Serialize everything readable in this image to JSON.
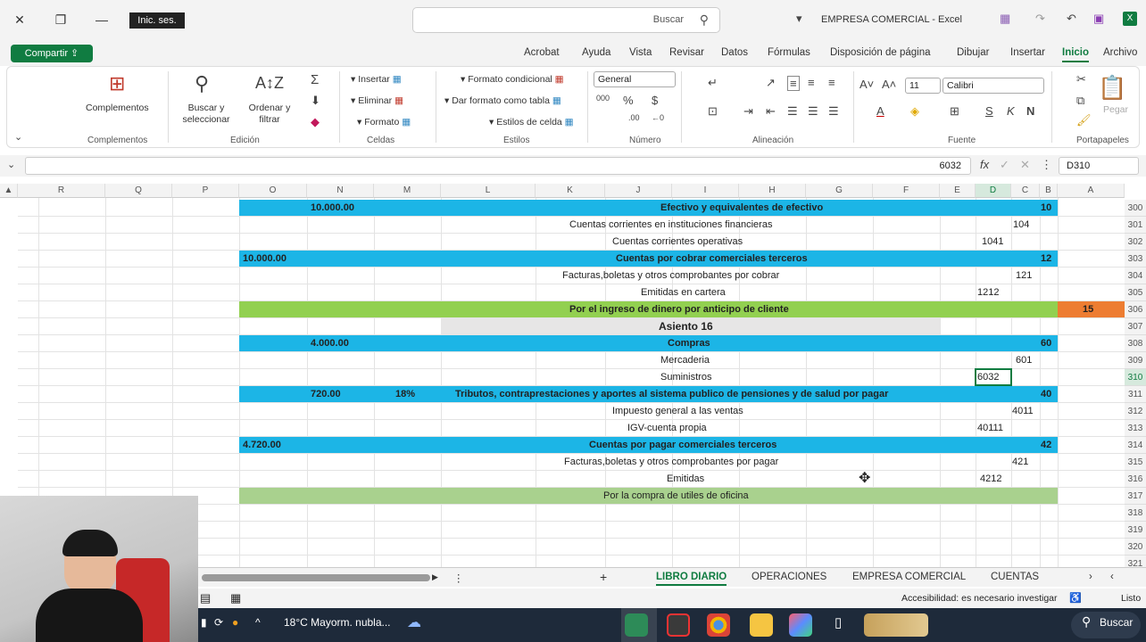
{
  "titlebar": {
    "signin": "Inic. ses.",
    "search_label": "Buscar",
    "title": "EMPRESA COMERCIAL  -  Excel"
  },
  "menu": {
    "tabs": [
      "Archivo",
      "Inicio",
      "Insertar",
      "Dibujar",
      "Disposición de página",
      "Fórmulas",
      "Datos",
      "Revisar",
      "Vista",
      "Ayuda",
      "Acrobat"
    ],
    "share": "Compartir"
  },
  "ribbon": {
    "groups": [
      "Portapapeles",
      "Fuente",
      "Alineación",
      "Número",
      "Estilos",
      "Celdas",
      "Edición",
      "Complementos"
    ],
    "paste": "Pegar",
    "font_name": "Calibri",
    "font_size": "11",
    "number_format": "General",
    "conditional": "Formato condicional",
    "as_table": "Dar formato como tabla",
    "cell_styles": "Estilos de celda",
    "insert": "Insertar",
    "delete": "Eliminar",
    "format": "Formato",
    "sort": "Ordenar y filtrar",
    "find": "Buscar y seleccionar",
    "addins": "Complementos"
  },
  "formula_bar": {
    "name_box": "D310",
    "formula": "6032"
  },
  "columns": [
    "A",
    "B",
    "C",
    "D",
    "E",
    "F",
    "G",
    "H",
    "I",
    "J",
    "K",
    "L",
    "M",
    "N",
    "O",
    "P",
    "Q",
    "R"
  ],
  "rows": [
    "300",
    "301",
    "302",
    "303",
    "304",
    "305",
    "306",
    "307",
    "308",
    "309",
    "310",
    "311",
    "312",
    "313",
    "314",
    "315",
    "316",
    "317",
    "318",
    "319",
    "320",
    "321"
  ],
  "cells": {
    "r300_code": "10",
    "r300_desc": "Efectivo y equivalentes de efectivo",
    "r300_debe": "10.000.00",
    "r301_code": "104",
    "r301_desc": "Cuentas corrientes en instituciones financieras",
    "r302_code": "1041",
    "r302_desc": "Cuentas corrientes operativas",
    "r303_code": "12",
    "r303_desc": "Cuentas por cobrar comerciales terceros",
    "r303_haber": "10.000.00",
    "r304_code": "121",
    "r304_desc": "Facturas,boletas y otros comprobantes por cobrar",
    "r305_code": "1212",
    "r305_desc": "Emitidas en cartera",
    "r306_num": "15",
    "r306_desc": "Por el ingreso de dinero por anticipo de cliente",
    "r307_desc": "Asiento 16",
    "r308_code": "60",
    "r308_desc": "Compras",
    "r308_debe": "4.000.00",
    "r309_code": "601",
    "r309_desc": "Mercaderia",
    "r310_code": "6032",
    "r310_desc": "Suministros",
    "r311_code": "40",
    "r311_desc": "Tributos, contraprestaciones y aportes al sistema publico de pensiones y de salud por pagar",
    "r311_pct": "18%",
    "r311_debe": "720.00",
    "r312_code": "4011",
    "r312_desc": "Impuesto general a las ventas",
    "r313_code": "40111",
    "r313_desc": "IGV-cuenta propia",
    "r314_code": "42",
    "r314_desc": "Cuentas por pagar comerciales terceros",
    "r314_haber": "4.720.00",
    "r315_code": "421",
    "r315_desc": "Facturas,boletas y otros comprobantes por pagar",
    "r316_code": "4212",
    "r316_desc": "Emitidas",
    "r317_desc": "Por la compra de utiles de oficina"
  },
  "sheets": [
    "CUENTAS",
    "EMPRESA COMERCIAL",
    "OPERACIONES",
    "LIBRO DIARIO"
  ],
  "status": {
    "ready": "Listo",
    "accessibility": "Accesibilidad: es necesario investigar"
  },
  "taskbar": {
    "search": "Buscar",
    "weather": "18°C  Mayorm. nubla..."
  },
  "colors": {
    "excel_green": "#107c41",
    "band_blue": "#1cb5e6",
    "band_green": "#92d050",
    "band_green_light": "#a9d18e",
    "orange": "#ed7d31"
  }
}
